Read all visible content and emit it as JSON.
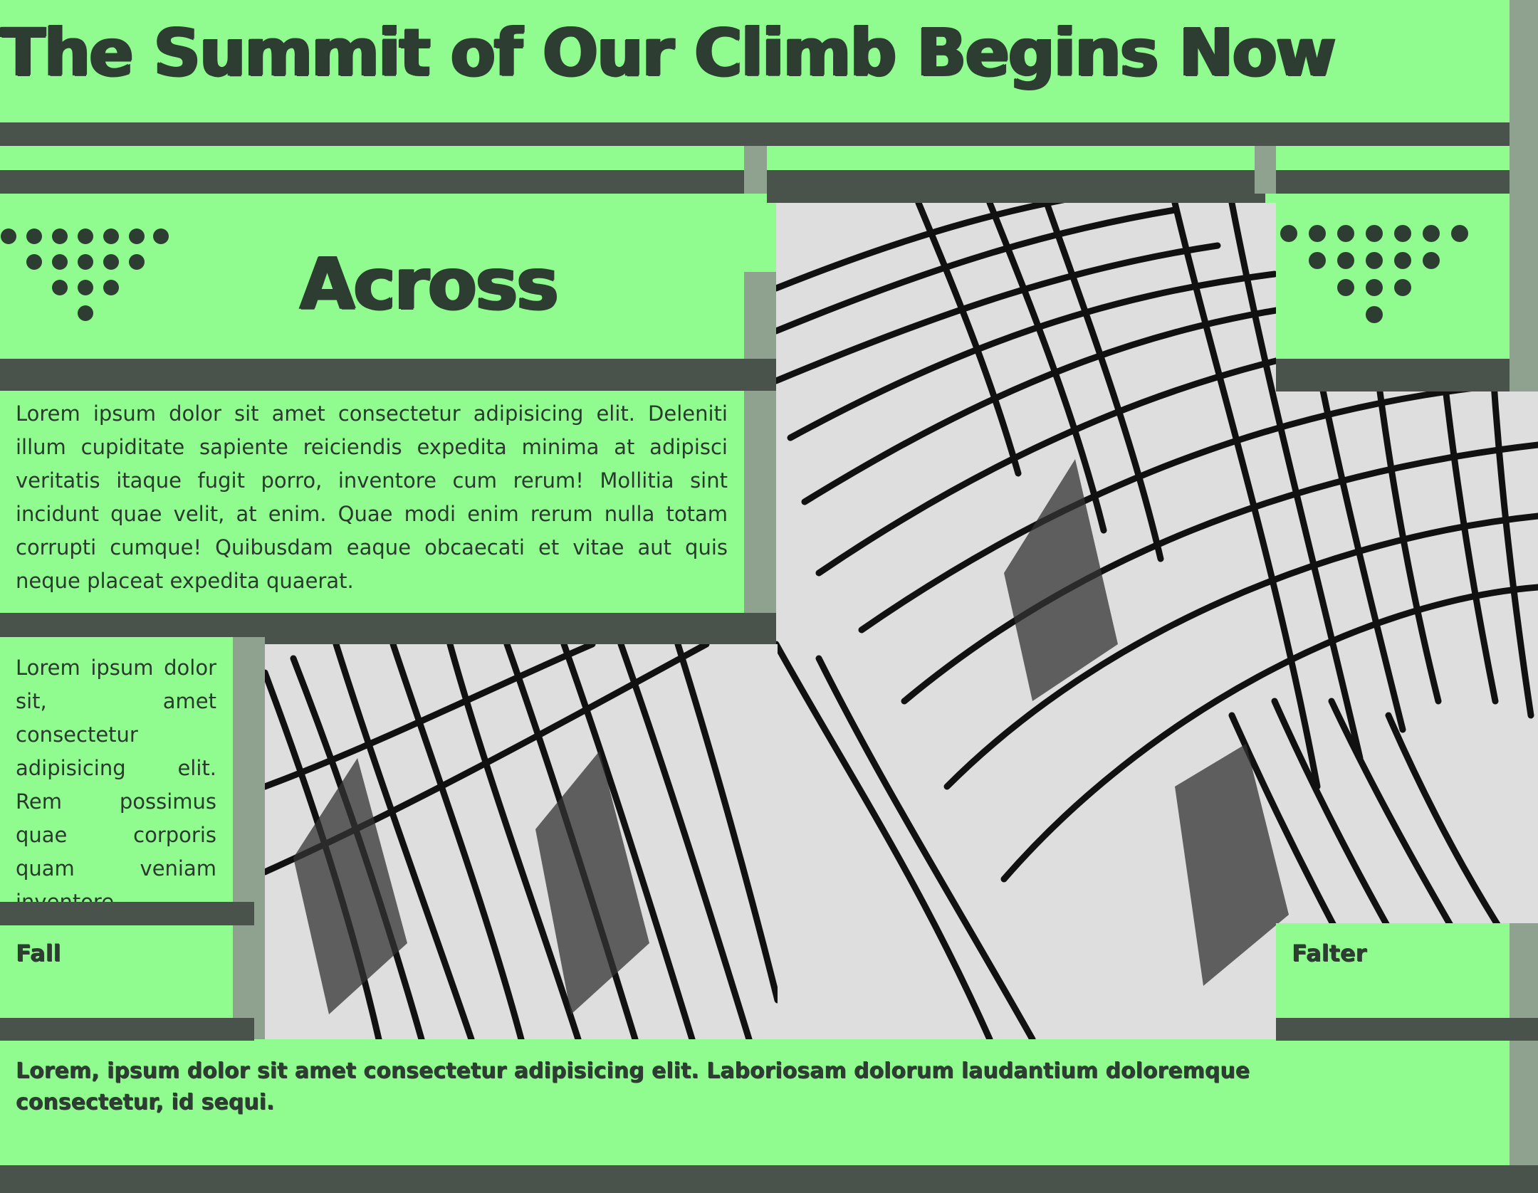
{
  "title": "The Summit of Our Climb Begins Now",
  "heading": "Across",
  "paragraph_main": "Lorem ipsum dolor sit amet consectetur adipisicing elit. Deleniti illum cupiditate sapiente reiciendis expedita minima at adipisci veritatis itaque fugit porro, inventore cum rerum! Mollitia sint incidunt quae velit, at enim. Quae modi enim rerum nulla totam corrupti cumque! Quibusdam eaque obcaecati et vitae aut quis neque placeat expedita quaerat.",
  "paragraph_side": "Lorem ipsum dolor sit, amet consectetur adipisicing elit. Rem possimus quae corporis quam veniam inventore.",
  "label_left": "Fall",
  "label_right": "Falter",
  "footer": "Lorem, ipsum dolor sit amet consectetur adipisicing elit. Laboriosam dolorum laudantium doloremque consectetur, id sequi.",
  "colors": {
    "panel": "#90fb8e",
    "bar": "#4a524c",
    "side": "#8fa18f",
    "text": "#2d3d31"
  },
  "icons": [
    "dot-triangle-icon",
    "dot-triangle-icon"
  ]
}
